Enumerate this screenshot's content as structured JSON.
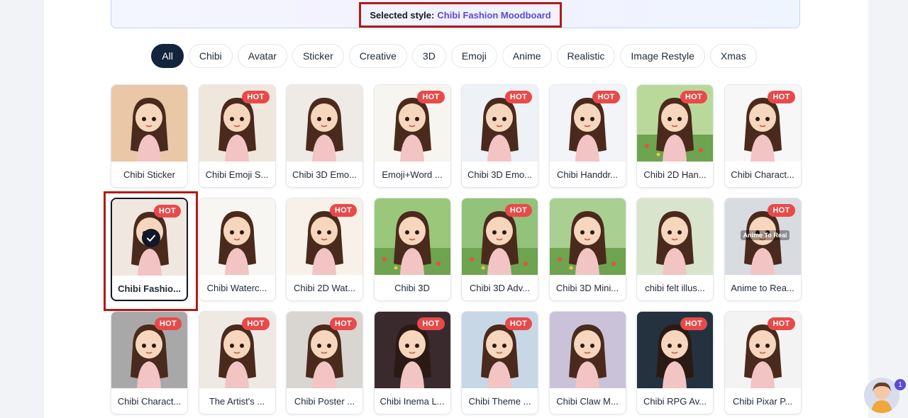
{
  "banner": {
    "prefix": "Selected style:",
    "value": "Chibi Fashion Moodboard"
  },
  "filters": [
    "All",
    "Chibi",
    "Avatar",
    "Sticker",
    "Creative",
    "3D",
    "Emoji",
    "Anime",
    "Realistic",
    "Image Restyle",
    "Xmas"
  ],
  "active_filter": "All",
  "hot_label": "HOT",
  "cards": [
    {
      "label": "Chibi Sticker",
      "hot": false,
      "bg": "#e9c7a7"
    },
    {
      "label": "Chibi Emoji S...",
      "hot": true,
      "bg": "#efe7dc"
    },
    {
      "label": "Chibi 3D Emo...",
      "hot": false,
      "bg": "#eeeae5"
    },
    {
      "label": "Emoji+Word ...",
      "hot": true,
      "bg": "#f7f5ef"
    },
    {
      "label": "Chibi 3D Emo...",
      "hot": true,
      "bg": "#eef1f6"
    },
    {
      "label": "Chibi Handdr...",
      "hot": true,
      "bg": "#f2f4f7"
    },
    {
      "label": "Chibi 2D Han...",
      "hot": true,
      "bg": "#b9d99a"
    },
    {
      "label": "Chibi Charact...",
      "hot": true,
      "bg": "#f7f7f7"
    },
    {
      "label": "Chibi Fashio...",
      "hot": true,
      "bg": "#efe7e0",
      "selected": true
    },
    {
      "label": "Chibi Waterc...",
      "hot": false,
      "bg": "#f8f6f3"
    },
    {
      "label": "Chibi 2D Wat...",
      "hot": true,
      "bg": "#f7f1ea"
    },
    {
      "label": "Chibi 3D",
      "hot": false,
      "bg": "#9bc77a"
    },
    {
      "label": "Chibi 3D Adv...",
      "hot": true,
      "bg": "#93c27a"
    },
    {
      "label": "Chibi 3D Mini...",
      "hot": false,
      "bg": "#a9cf92"
    },
    {
      "label": "chibi felt illus...",
      "hot": false,
      "bg": "#d9e4cc"
    },
    {
      "label": "Anime to Rea...",
      "hot": true,
      "bg": "#d8dbe0",
      "overlay": "Anime To Real"
    },
    {
      "label": "Chibi Charact...",
      "hot": true,
      "bg": "#a8a8a8"
    },
    {
      "label": "The Artist's ...",
      "hot": true,
      "bg": "#efe9e4"
    },
    {
      "label": "Chibi Poster ...",
      "hot": true,
      "bg": "#d9d6d2"
    },
    {
      "label": "Chibi Inema L...",
      "hot": true,
      "bg": "#3a2a2e"
    },
    {
      "label": "Chibi Theme ...",
      "hot": true,
      "bg": "#c8d7e6"
    },
    {
      "label": "Chibi Claw M...",
      "hot": false,
      "bg": "#c9c2d8"
    },
    {
      "label": "Chibi RPG Av...",
      "hot": true,
      "bg": "#24323f"
    },
    {
      "label": "Chibi Pixar P...",
      "hot": true,
      "bg": "#f3f3f3"
    }
  ],
  "assistant": {
    "badge": "1"
  },
  "colors": {
    "accent": "#5b49d8",
    "hot": "#e84a4a",
    "active_chip": "#13243d",
    "highlight": "#b11a1a"
  }
}
